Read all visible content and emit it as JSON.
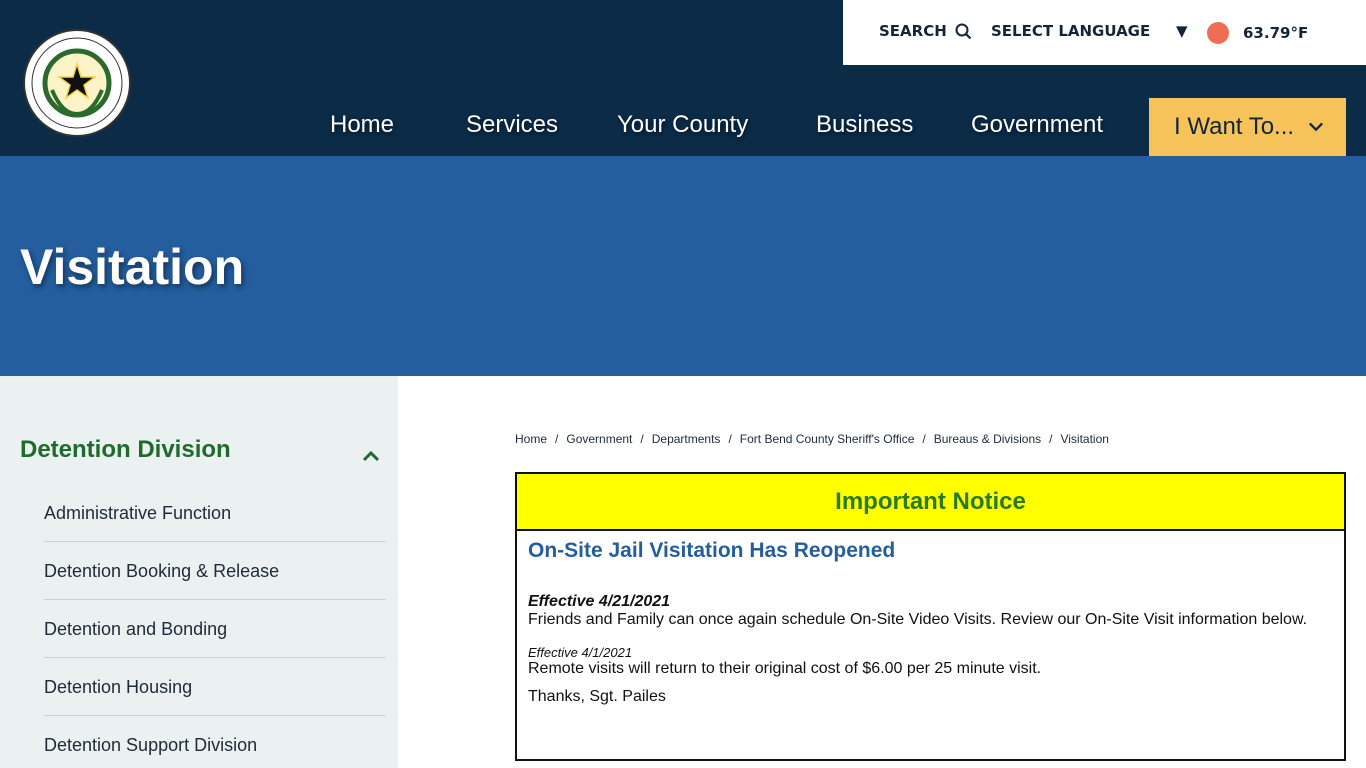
{
  "header": {
    "seal_text": [
      "THE STATE OF TEXAS",
      "FORT BEND COUNTY"
    ],
    "utility": {
      "search_label": "SEARCH",
      "language_label": "SELECT LANGUAGE",
      "temperature": "63.79°F"
    },
    "nav": [
      {
        "label": "Home"
      },
      {
        "label": "Services"
      },
      {
        "label": "Your County"
      },
      {
        "label": "Business"
      },
      {
        "label": "Government"
      },
      {
        "label": "I Want To..."
      }
    ]
  },
  "hero": {
    "title": "Visitation"
  },
  "sidebar": {
    "title": "Detention Division",
    "items": [
      {
        "label": "Administrative Function"
      },
      {
        "label": "Detention Booking & Release"
      },
      {
        "label": "Detention and Bonding"
      },
      {
        "label": "Detention Housing"
      },
      {
        "label": "Detention Support Division"
      }
    ]
  },
  "breadcrumb": [
    "Home",
    "Government",
    "Departments",
    "Fort Bend County Sheriff's Office",
    "Bureaus & Divisions",
    "Visitation"
  ],
  "notice": {
    "heading": "Important Notice",
    "subheading": "On-Site Jail Visitation Has Reopened",
    "effective1": "Effective 4/21/2021",
    "paragraph1": "Friends and Family can once again schedule On-Site Video Visits.  Review our On-Site Visit information below.",
    "effective2": "Effective 4/1/2021",
    "paragraph2": "Remote visits will return to their original cost of $6.00 per 25 minute visit.",
    "signoff": "Thanks, Sgt. Pailes"
  },
  "colors": {
    "header_bg": "#0b2b47",
    "hero_bg": "#245e9f",
    "accent_yellow": "#f6c35a",
    "sidebar_green": "#1f6b2d",
    "notice_yellow": "#ffff00"
  }
}
